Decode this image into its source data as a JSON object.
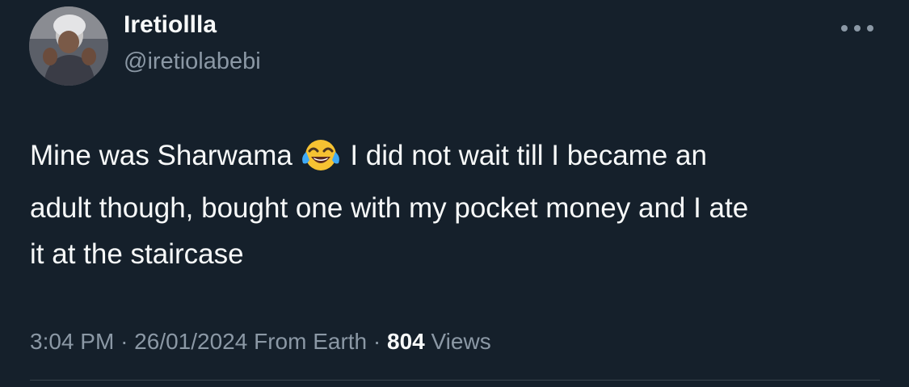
{
  "author": {
    "display_name": "Iretiollla",
    "handle": "@iretiolabebi"
  },
  "tweet": {
    "text_lines": [
      {
        "before_emoji": "Mine was Sharwama",
        "after_emoji": "I did not wait till I became an"
      },
      {
        "text": "adult though, bought one with my pocket money and I ate"
      },
      {
        "text": "it at the staircase"
      }
    ],
    "emoji": "face-with-tears-of-joy-icon"
  },
  "meta": {
    "time": "3:04 PM",
    "separator": "·",
    "date": "26/01/2024",
    "source": "From Earth",
    "views_count": "804",
    "views_label": "Views"
  },
  "icons": {
    "more": "more-horizontal-icon"
  },
  "colors": {
    "background": "#15202b",
    "primary_text": "#f7f9f9",
    "secondary_text": "#8b98a5",
    "divider": "#38444d"
  }
}
